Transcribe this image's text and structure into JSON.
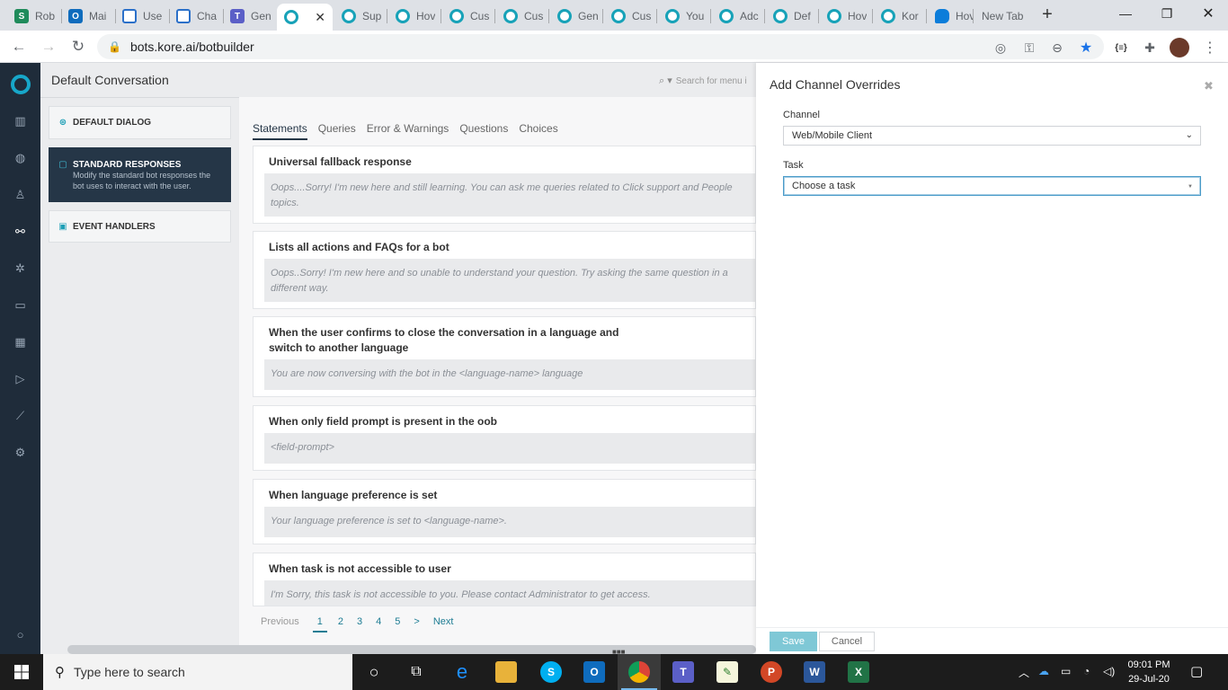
{
  "browser": {
    "tabs": [
      {
        "title": "Rob",
        "favicon": "S",
        "color": "#1f8b5b"
      },
      {
        "title": "Mai",
        "favicon": "O",
        "color": "#0f6cbd"
      },
      {
        "title": "Use",
        "favicon": "",
        "color": "#2b70c9"
      },
      {
        "title": "Cha",
        "favicon": "",
        "color": "#2b70c9"
      },
      {
        "title": "Gen",
        "favicon": "T",
        "color": "#5b5fc7"
      },
      {
        "title": "",
        "favicon": "",
        "color": "#17a2b8"
      },
      {
        "title": "Sup",
        "favicon": "",
        "color": "#17a2b8"
      },
      {
        "title": "Hov",
        "favicon": "",
        "color": "#17a2b8"
      },
      {
        "title": "Cus",
        "favicon": "",
        "color": "#17a2b8"
      },
      {
        "title": "Cus",
        "favicon": "",
        "color": "#17a2b8"
      },
      {
        "title": "Gen",
        "favicon": "",
        "color": "#17a2b8"
      },
      {
        "title": "Cus",
        "favicon": "",
        "color": "#17a2b8"
      },
      {
        "title": "You",
        "favicon": "",
        "color": "#17a2b8"
      },
      {
        "title": "Adc",
        "favicon": "",
        "color": "#17a2b8"
      },
      {
        "title": "Def",
        "favicon": "",
        "color": "#17a2b8"
      },
      {
        "title": "Hov",
        "favicon": "",
        "color": "#17a2b8"
      },
      {
        "title": "Kor",
        "favicon": "",
        "color": "#17a2b8"
      },
      {
        "title": "Hov",
        "favicon": "",
        "color": "#0b7dda"
      },
      {
        "title": "New Tab",
        "favicon": "",
        "color": ""
      }
    ],
    "url": "bots.kore.ai/botbuilder"
  },
  "app": {
    "conversation_title": "Default Conversation",
    "menu_search_placeholder": "Search for menu i",
    "left_cards": [
      {
        "label": "DEFAULT DIALOG",
        "desc": ""
      },
      {
        "label": "STANDARD RESPONSES",
        "desc": "Modify the standard bot responses the bot uses to interact with the user."
      },
      {
        "label": "EVENT HANDLERS",
        "desc": ""
      }
    ],
    "tabs": [
      "Statements",
      "Queries",
      "Error & Warnings",
      "Questions",
      "Choices"
    ],
    "responses": [
      {
        "title": "Universal fallback response",
        "body": "Oops....Sorry! I'm new here and still learning. You can ask me queries related to Click support and People topics."
      },
      {
        "title": "Lists all actions and FAQs for a bot",
        "body": "Oops..Sorry! I'm new here and so unable to understand your question. Try asking the same question in a different way."
      },
      {
        "title": "When the user confirms to close the conversation in a language and switch to another language",
        "body": "You are now conversing with the bot in the <language-name> language"
      },
      {
        "title": "When only field prompt is present in the oob",
        "body": "<field-prompt>"
      },
      {
        "title": "When language preference is set",
        "body": "Your language preference is set to <language-name>."
      },
      {
        "title": "When task is not accessible to user",
        "body": "I'm Sorry, this task is not accessible to you. Please contact Administrator to get access."
      }
    ],
    "pager": {
      "previous": "Previous",
      "pages": [
        "1",
        "2",
        "3",
        "4",
        "5",
        ">"
      ],
      "next": "Next",
      "current": "1"
    }
  },
  "panel": {
    "title": "Add Channel Overrides",
    "channel_label": "Channel",
    "channel_value": "Web/Mobile Client",
    "task_label": "Task",
    "task_value": "Choose a task",
    "save": "Save",
    "cancel": "Cancel"
  },
  "taskbar": {
    "search_placeholder": "Type here to search",
    "time": "09:01 PM",
    "date": "29-Jul-20"
  },
  "colors": {
    "accent": "#17a2b8",
    "nav_dark": "#1f2c3a",
    "save_button": "#7fc8d6"
  }
}
